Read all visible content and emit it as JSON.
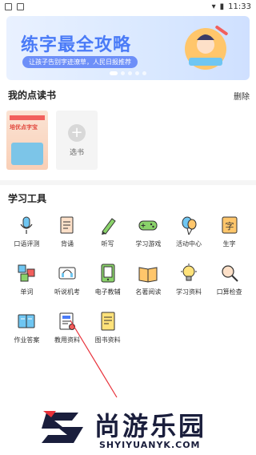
{
  "status_bar": {
    "time": "11:33"
  },
  "banner": {
    "title": "练字最全攻略",
    "subtitle": "让孩子告别字迹潦草，人民日报推荐",
    "dots": 5,
    "active_dot": 0
  },
  "my_books": {
    "title": "我的点读书",
    "delete_label": "删除",
    "book_cover_text": "培优点字宝",
    "add_label": "选书"
  },
  "tools_section": {
    "title": "学习工具",
    "items": [
      {
        "label": "口语评测",
        "icon": "microphone-icon"
      },
      {
        "label": "背诵",
        "icon": "book-recite-icon"
      },
      {
        "label": "听写",
        "icon": "pen-icon"
      },
      {
        "label": "学习游戏",
        "icon": "gamepad-icon"
      },
      {
        "label": "活动中心",
        "icon": "balloon-icon"
      },
      {
        "label": "生字",
        "icon": "character-card-icon"
      },
      {
        "label": "单词",
        "icon": "abc-blocks-icon"
      },
      {
        "label": "听说机考",
        "icon": "headset-exam-icon"
      },
      {
        "label": "电子教辅",
        "icon": "tablet-book-icon"
      },
      {
        "label": "名著阅读",
        "icon": "open-book-icon"
      },
      {
        "label": "学习资料",
        "icon": "lightbulb-icon"
      },
      {
        "label": "口算检查",
        "icon": "magnifier-icon"
      },
      {
        "label": "作业答案",
        "icon": "homework-book-icon"
      },
      {
        "label": "教用资料",
        "icon": "teacher-material-icon"
      },
      {
        "label": "图书资料",
        "icon": "library-doc-icon"
      }
    ]
  },
  "watermark": {
    "text": "尚游乐园",
    "url": "SHYIYUANYK.COM"
  },
  "colors": {
    "accent": "#4a7bf7",
    "watermark": "#1a1e3c",
    "brand_red": "#e8313a"
  }
}
